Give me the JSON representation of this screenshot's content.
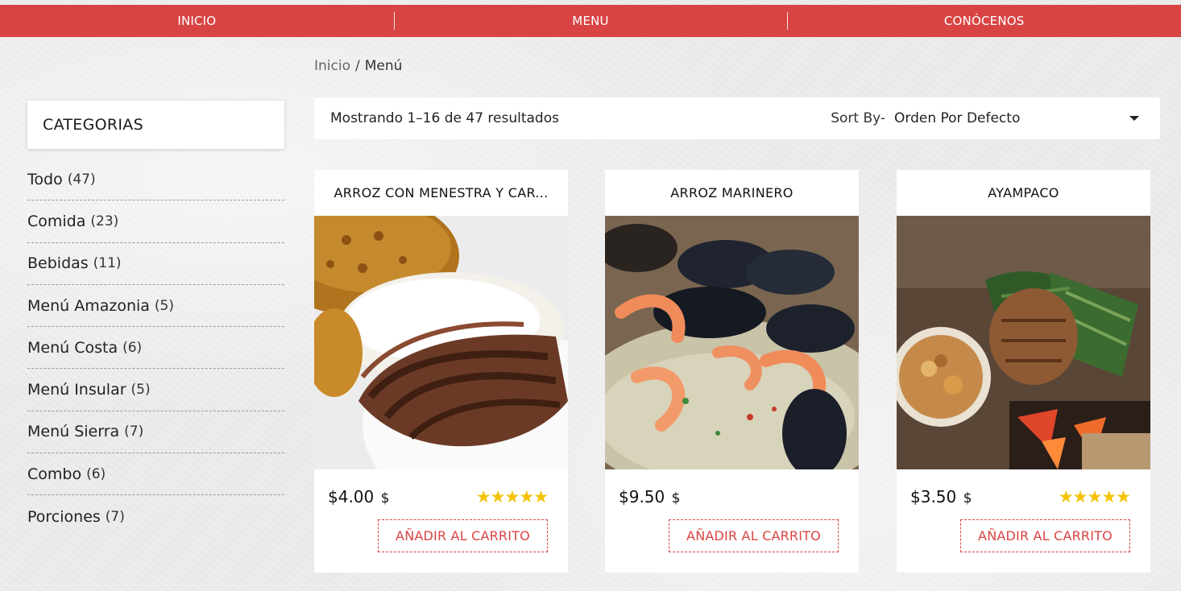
{
  "nav": {
    "items": [
      "INICIO",
      "MENU",
      "CONÓCENOS"
    ]
  },
  "breadcrumb": {
    "home": "Inicio",
    "separator": "/",
    "current": "Menú"
  },
  "sidebar": {
    "title": "CATEGORIAS",
    "categories": [
      {
        "label": "Todo",
        "count": "(47)"
      },
      {
        "label": "Comida",
        "count": "(23)"
      },
      {
        "label": "Bebidas",
        "count": "(11)"
      },
      {
        "label": "Menú Amazonia",
        "count": "(5)"
      },
      {
        "label": "Menú Costa",
        "count": "(6)"
      },
      {
        "label": "Menú Insular",
        "count": "(5)"
      },
      {
        "label": "Menú Sierra",
        "count": "(7)"
      },
      {
        "label": "Combo",
        "count": "(6)"
      },
      {
        "label": "Porciones",
        "count": "(7)"
      }
    ]
  },
  "toolbar": {
    "results": "Mostrando 1–16 de 47 resultados",
    "sort_label": "Sort By-",
    "sort_value": "Orden Por Defecto"
  },
  "products": [
    {
      "title": "ARROZ CON MENESTRA Y CAR...",
      "price": "$4.00",
      "currency": "$",
      "stars": "★★★★★",
      "button": "AÑADIR AL CARRITO"
    },
    {
      "title": "ARROZ MARINERO",
      "price": "$9.50",
      "currency": "$",
      "stars": "",
      "button": "AÑADIR AL CARRITO"
    },
    {
      "title": "AYAMPACO",
      "price": "$3.50",
      "currency": "$",
      "stars": "★★★★★",
      "button": "AÑADIR AL CARRITO"
    }
  ],
  "colors": {
    "accent": "#d84444",
    "star": "#f5c200",
    "background": "#ececec"
  }
}
